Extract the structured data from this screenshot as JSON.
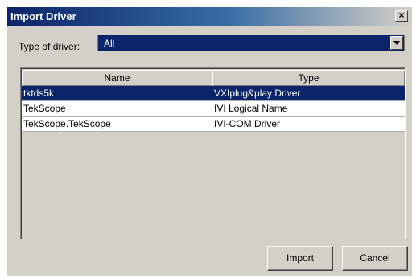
{
  "window": {
    "title": "Import Driver",
    "close_label": "×"
  },
  "filter": {
    "label": "Type of driver:",
    "value": "All"
  },
  "table": {
    "headers": {
      "name": "Name",
      "type": "Type"
    },
    "rows": [
      {
        "name": "tktds5k",
        "type": "VXIplug&play Driver",
        "selected": true
      },
      {
        "name": "TekScope",
        "type": "IVI Logical Name",
        "selected": false
      },
      {
        "name": "TekScope.TekScope",
        "type": "IVI-COM Driver",
        "selected": false
      }
    ]
  },
  "buttons": {
    "import": "Import",
    "cancel": "Cancel"
  },
  "colors": {
    "selection": "#0a246a",
    "dialog_bg": "#d4d0c8"
  }
}
